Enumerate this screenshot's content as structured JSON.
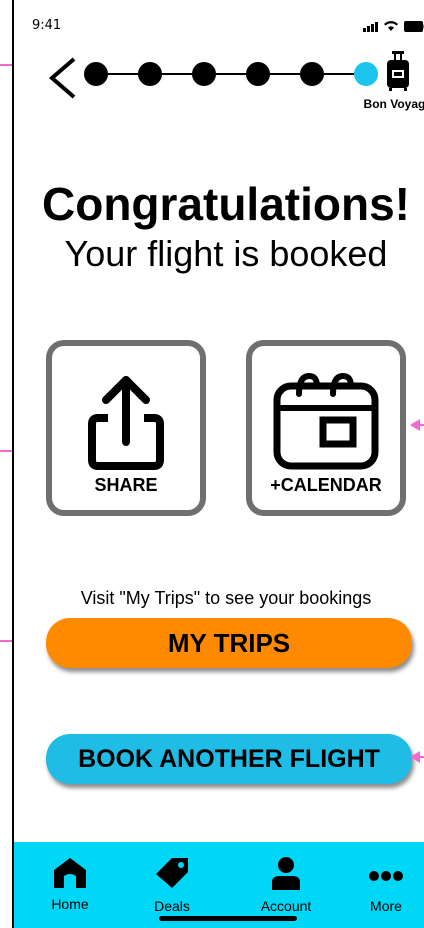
{
  "status": {
    "time": "9:41"
  },
  "progress": {
    "steps_total": 6,
    "current_step": 6,
    "end_label": "Bon Voyage!"
  },
  "headline": {
    "title": "Congratulations!",
    "subtitle": "Your flight is booked"
  },
  "actions": [
    {
      "label": "SHARE",
      "icon": "share-icon"
    },
    {
      "label": "+CALENDAR",
      "icon": "calendar-icon"
    }
  ],
  "hint": "Visit \"My Trips\" to see your bookings",
  "buttons": {
    "my_trips": "MY TRIPS",
    "book_another": "BOOK ANOTHER FLIGHT"
  },
  "tabs": [
    {
      "label": "Home",
      "icon": "home-icon"
    },
    {
      "label": "Deals",
      "icon": "tag-icon"
    },
    {
      "label": "Account",
      "icon": "user-icon"
    },
    {
      "label": "More",
      "icon": "more-icon"
    }
  ],
  "colors": {
    "accent_blue": "#1fbde6",
    "tabbar": "#00d6f5",
    "orange": "#ff8a00",
    "annotation": "#f26ad0"
  }
}
